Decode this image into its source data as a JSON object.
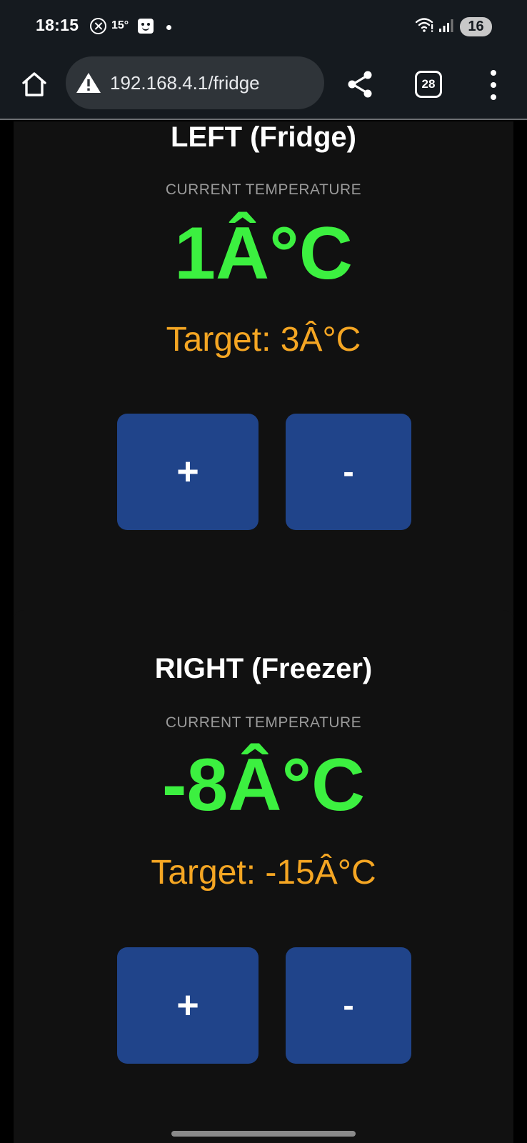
{
  "status_bar": {
    "time": "18:15",
    "temperature": "15°",
    "battery": "16"
  },
  "browser": {
    "url": "192.168.4.1/fridge",
    "tab_count": "28"
  },
  "panels": [
    {
      "title": "LEFT (Fridge)",
      "label": "CURRENT TEMPERATURE",
      "current": "1Â°C",
      "target": "Target: 3Â°C",
      "plus_label": "+",
      "minus_label": "-"
    },
    {
      "title": "RIGHT (Freezer)",
      "label": "CURRENT TEMPERATURE",
      "current": "-8Â°C",
      "target": "Target: -15Â°C",
      "plus_label": "+",
      "minus_label": "-"
    }
  ],
  "colors": {
    "current_temp": "#3cf040",
    "target_temp": "#f5a623",
    "button": "#20448a",
    "panel": "#111111"
  }
}
